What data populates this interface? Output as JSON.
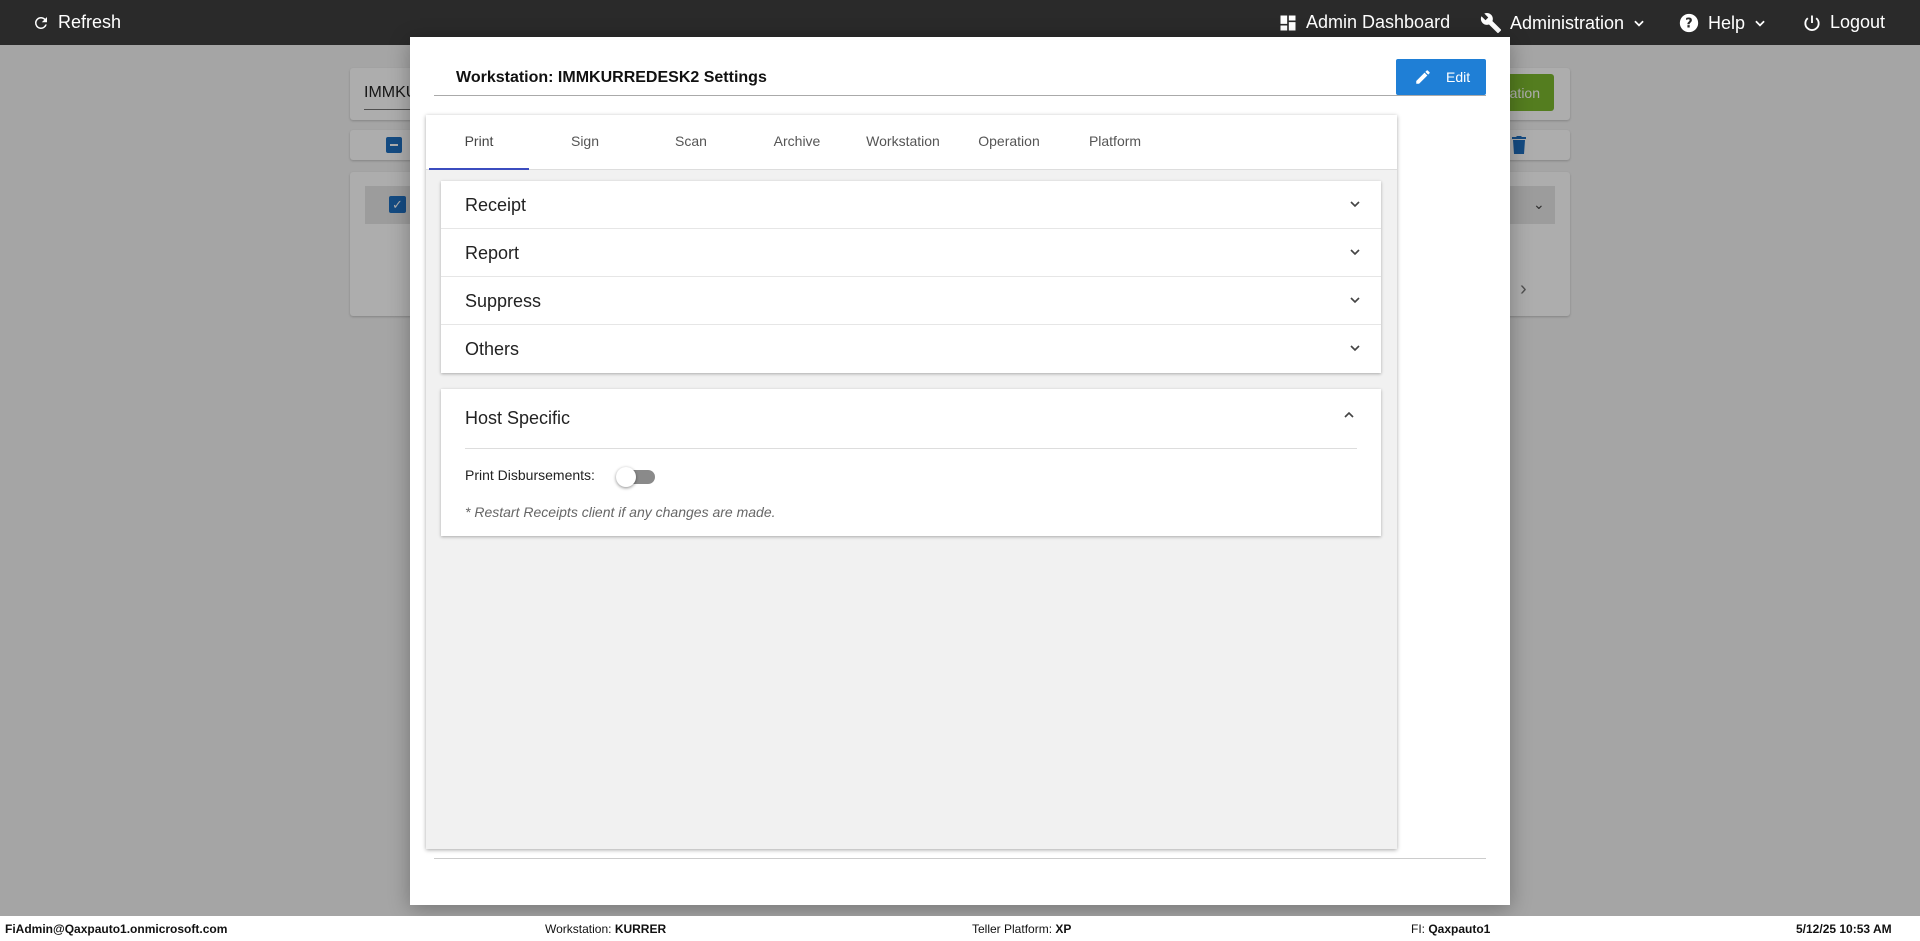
{
  "topbar": {
    "refresh_label": "Refresh",
    "admin_dashboard_label": "Admin Dashboard",
    "administration_label": "Administration",
    "help_label": "Help",
    "logout_label": "Logout"
  },
  "background": {
    "search_text": "IMMKU",
    "green_button_label": "ation"
  },
  "modal": {
    "title": "Workstation: IMMKURREDESK2 Settings",
    "edit_label": "Edit",
    "tabs": [
      {
        "label": "Print",
        "active": true
      },
      {
        "label": "Sign",
        "active": false
      },
      {
        "label": "Scan",
        "active": false
      },
      {
        "label": "Archive",
        "active": false
      },
      {
        "label": "Workstation",
        "active": false
      },
      {
        "label": "Operation",
        "active": false
      },
      {
        "label": "Platform",
        "active": false
      }
    ],
    "accordion": [
      {
        "label": "Receipt"
      },
      {
        "label": "Report"
      },
      {
        "label": "Suppress"
      },
      {
        "label": "Others"
      }
    ],
    "host_specific": {
      "title": "Host Specific",
      "print_disbursements_label": "Print Disbursements:",
      "print_disbursements_on": false,
      "note": "* Restart Receipts client if any changes are made."
    }
  },
  "statusbar": {
    "user": "FiAdmin@Qaxpauto1.onmicrosoft.com",
    "workstation_label": "Workstation:",
    "workstation_value": "KURRER",
    "teller_platform_label": "Teller Platform:",
    "teller_platform_value": "XP",
    "fi_label": "FI:",
    "fi_value": "Qaxpauto1",
    "datetime": "5/12/25 10:53 AM"
  },
  "colors": {
    "topbar": "#2a2a2a",
    "edit_button": "#1f7fd6",
    "active_tab_underline": "#3b4cbf",
    "green_button": "#7cb82f"
  }
}
